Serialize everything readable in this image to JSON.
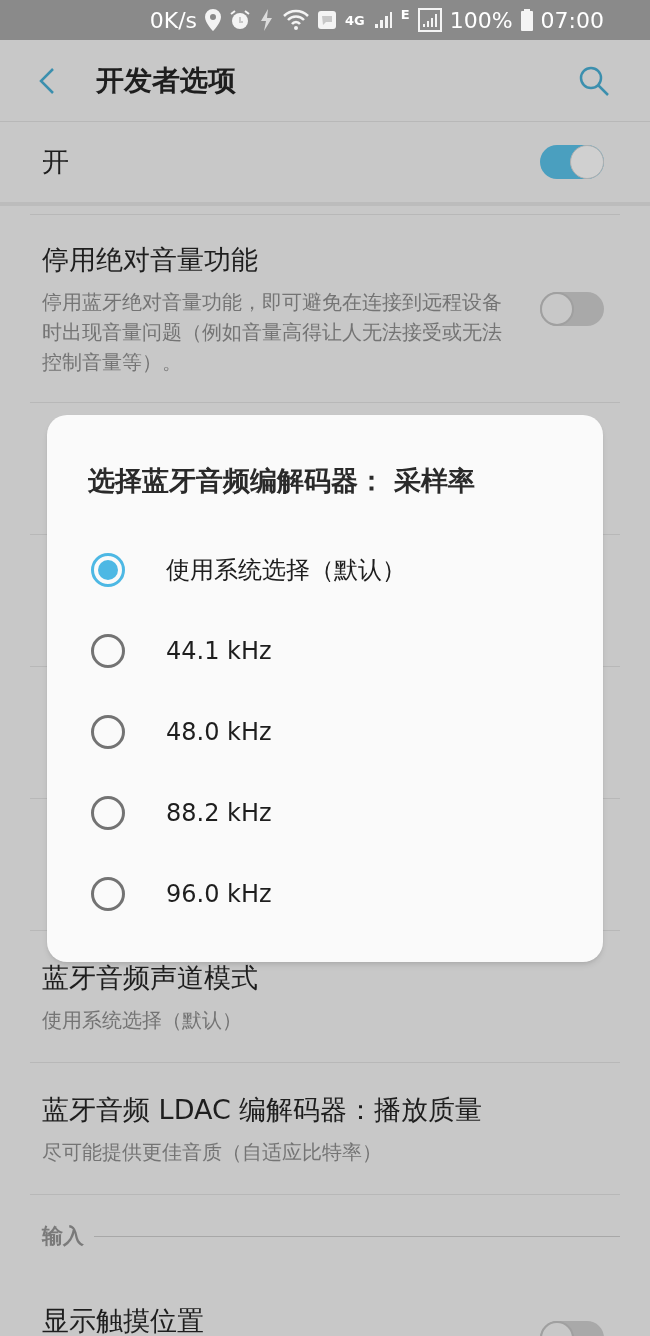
{
  "status_bar": {
    "speed": "0K/s",
    "network": "4G",
    "signal2_label": "E",
    "battery": "100%",
    "time": "07:00"
  },
  "header": {
    "title": "开发者选项"
  },
  "master_switch": {
    "label": "开",
    "on": true
  },
  "settings": [
    {
      "kind": "toggle",
      "title": "停用绝对音量功能",
      "subtitle": "停用蓝牙绝对音量功能，即可避免在连接到远程设备时出现音量问题（例如音量高得让人无法接受或无法控制音量等）。",
      "on": false
    },
    {
      "kind": "hidden"
    },
    {
      "kind": "hidden"
    },
    {
      "kind": "hidden"
    },
    {
      "kind": "hidden"
    },
    {
      "kind": "plain",
      "title": "蓝牙音频声道模式",
      "subtitle": "使用系统选择（默认）"
    },
    {
      "kind": "plain",
      "title": "蓝牙音频 LDAC 编解码器：播放质量",
      "subtitle": "尽可能提供更佳音质（自适应比特率）"
    }
  ],
  "section": {
    "title": "输入"
  },
  "bottom_item": {
    "title": "显示触摸位置",
    "on": false
  },
  "dialog": {
    "title": "选择蓝牙音频编解码器： 采样率",
    "options": [
      {
        "label": "使用系统选择（默认）",
        "selected": true
      },
      {
        "label": "44.1 kHz",
        "selected": false
      },
      {
        "label": "48.0 kHz",
        "selected": false
      },
      {
        "label": "88.2 kHz",
        "selected": false
      },
      {
        "label": "96.0 kHz",
        "selected": false
      }
    ]
  }
}
